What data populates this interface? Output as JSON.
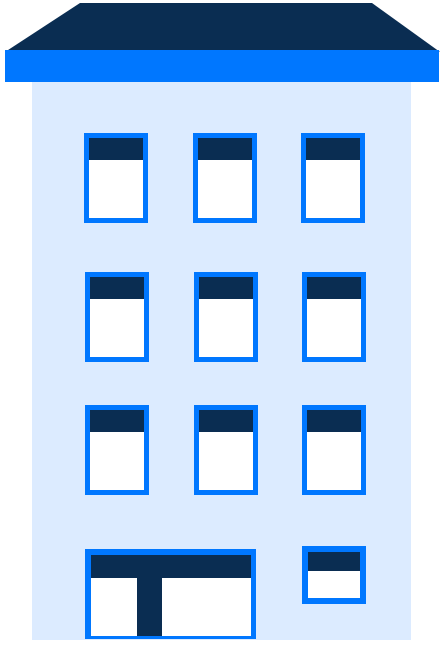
{
  "illustration": {
    "subject": "building-icon",
    "colors": {
      "roof": "#0a2d52",
      "cornice": "#0077ff",
      "facade": "#dcebff",
      "window_frame": "#0077ff",
      "window_glass": "#ffffff",
      "window_blind": "#0a2d52",
      "door_frame": "#0077ff",
      "door_panel": "#0a2d52",
      "door_glass": "#ffffff"
    },
    "window_rows": 3,
    "windows_per_row": 3
  }
}
